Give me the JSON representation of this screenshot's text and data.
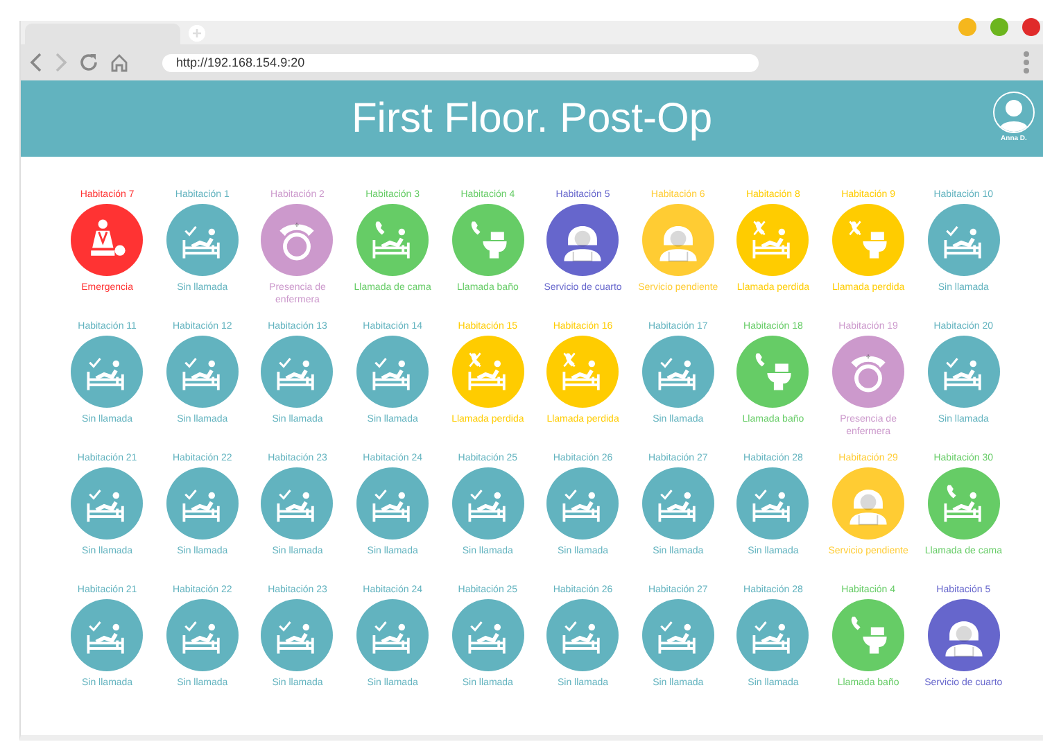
{
  "browser": {
    "url": "http://192.168.154.9:20"
  },
  "header": {
    "title": "First Floor. Post-Op",
    "user": "Anna D."
  },
  "rooms": [
    {
      "name": "Habitación 7",
      "status": "Emergencia",
      "kind": "emergency",
      "color": "#ff3333"
    },
    {
      "name": "Habitación 1",
      "status": "Sin llamada",
      "kind": "no-call",
      "color": "#62b3bf"
    },
    {
      "name": "Habitación 2",
      "status": "Presencia de enfermera",
      "kind": "nurse",
      "color": "#cc99cc"
    },
    {
      "name": "Habitación 3",
      "status": "Llamada de cama",
      "kind": "bed-call",
      "color": "#66cc66"
    },
    {
      "name": "Habitación 4",
      "status": "Llamada baño",
      "kind": "bath-call",
      "color": "#66cc66"
    },
    {
      "name": "Habitación 5",
      "status": "Servicio de cuarto",
      "kind": "room-service",
      "color": "#6666cc"
    },
    {
      "name": "Habitación 6",
      "status": "Servicio pendiente",
      "kind": "room-service",
      "color": "#ffcc33"
    },
    {
      "name": "Habitación 8",
      "status": "Llamada perdida",
      "kind": "missed-bed",
      "color": "#ffcc00"
    },
    {
      "name": "Habitación 9",
      "status": "Llamada perdida",
      "kind": "missed-bath",
      "color": "#ffcc00"
    },
    {
      "name": "Habitación 10",
      "status": "Sin llamada",
      "kind": "no-call",
      "color": "#62b3bf"
    },
    {
      "name": "Habitación 11",
      "status": "Sin llamada",
      "kind": "no-call",
      "color": "#62b3bf"
    },
    {
      "name": "Habitación 12",
      "status": "Sin llamada",
      "kind": "no-call",
      "color": "#62b3bf"
    },
    {
      "name": "Habitación 13",
      "status": "Sin llamada",
      "kind": "no-call",
      "color": "#62b3bf"
    },
    {
      "name": "Habitación 14",
      "status": "Sin llamada",
      "kind": "no-call",
      "color": "#62b3bf"
    },
    {
      "name": "Habitación 15",
      "status": "Llamada perdida",
      "kind": "missed-bed",
      "color": "#ffcc00"
    },
    {
      "name": "Habitación 16",
      "status": "Llamada perdida",
      "kind": "missed-bed",
      "color": "#ffcc00"
    },
    {
      "name": "Habitación 17",
      "status": "Sin llamada",
      "kind": "no-call",
      "color": "#62b3bf"
    },
    {
      "name": "Habitación 18",
      "status": "Llamada baño",
      "kind": "bath-call",
      "color": "#66cc66"
    },
    {
      "name": "Habitación 19",
      "status": "Presencia de enfermera",
      "kind": "nurse",
      "color": "#cc99cc"
    },
    {
      "name": "Habitación 20",
      "status": "Sin llamada",
      "kind": "no-call",
      "color": "#62b3bf"
    },
    {
      "name": "Habitación 21",
      "status": "Sin llamada",
      "kind": "no-call",
      "color": "#62b3bf"
    },
    {
      "name": "Habitación 22",
      "status": "Sin llamada",
      "kind": "no-call",
      "color": "#62b3bf"
    },
    {
      "name": "Habitación 23",
      "status": "Sin llamada",
      "kind": "no-call",
      "color": "#62b3bf"
    },
    {
      "name": "Habitación 24",
      "status": "Sin llamada",
      "kind": "no-call",
      "color": "#62b3bf"
    },
    {
      "name": "Habitación 25",
      "status": "Sin llamada",
      "kind": "no-call",
      "color": "#62b3bf"
    },
    {
      "name": "Habitación 26",
      "status": "Sin llamada",
      "kind": "no-call",
      "color": "#62b3bf"
    },
    {
      "name": "Habitación 27",
      "status": "Sin llamada",
      "kind": "no-call",
      "color": "#62b3bf"
    },
    {
      "name": "Habitación 28",
      "status": "Sin llamada",
      "kind": "no-call",
      "color": "#62b3bf"
    },
    {
      "name": "Habitación 29",
      "status": "Servicio pendiente",
      "kind": "room-service",
      "color": "#ffcc33"
    },
    {
      "name": "Habitación 30",
      "status": "Llamada de cama",
      "kind": "bed-call",
      "color": "#66cc66"
    },
    {
      "name": "Habitación 21",
      "status": "Sin llamada",
      "kind": "no-call",
      "color": "#62b3bf"
    },
    {
      "name": "Habitación 22",
      "status": "Sin llamada",
      "kind": "no-call",
      "color": "#62b3bf"
    },
    {
      "name": "Habitación 23",
      "status": "Sin llamada",
      "kind": "no-call",
      "color": "#62b3bf"
    },
    {
      "name": "Habitación 24",
      "status": "Sin llamada",
      "kind": "no-call",
      "color": "#62b3bf"
    },
    {
      "name": "Habitación 25",
      "status": "Sin llamada",
      "kind": "no-call",
      "color": "#62b3bf"
    },
    {
      "name": "Habitación 26",
      "status": "Sin llamada",
      "kind": "no-call",
      "color": "#62b3bf"
    },
    {
      "name": "Habitación 27",
      "status": "Sin llamada",
      "kind": "no-call",
      "color": "#62b3bf"
    },
    {
      "name": "Habitación 28",
      "status": "Sin llamada",
      "kind": "no-call",
      "color": "#62b3bf"
    },
    {
      "name": "Habitación 4",
      "status": "Llamada baño",
      "kind": "bath-call",
      "color": "#66cc66"
    },
    {
      "name": "Habitación 5",
      "status": "Servicio de cuarto",
      "kind": "room-service",
      "color": "#6666cc"
    }
  ]
}
